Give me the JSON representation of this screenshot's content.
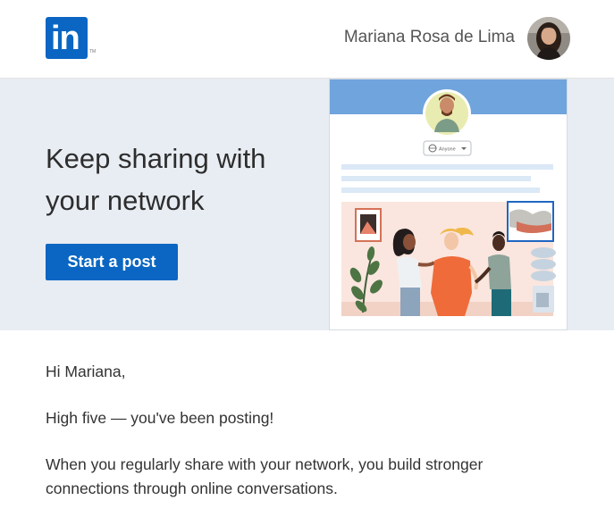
{
  "header": {
    "logo_text": "in",
    "logo_mark": "TM",
    "user_name": "Mariana Rosa de Lima"
  },
  "hero": {
    "title": "Keep sharing with your network",
    "cta_label": "Start a post",
    "illustration": {
      "visibility_label": "Anyone"
    }
  },
  "message": {
    "greeting": "Hi Mariana,",
    "line1": "High five — you've been posting!",
    "line2": "When you regularly share with your network, you build stronger connections through online conversations."
  },
  "colors": {
    "brand": "#0a66c2",
    "hero_bg": "#e8edf3"
  }
}
